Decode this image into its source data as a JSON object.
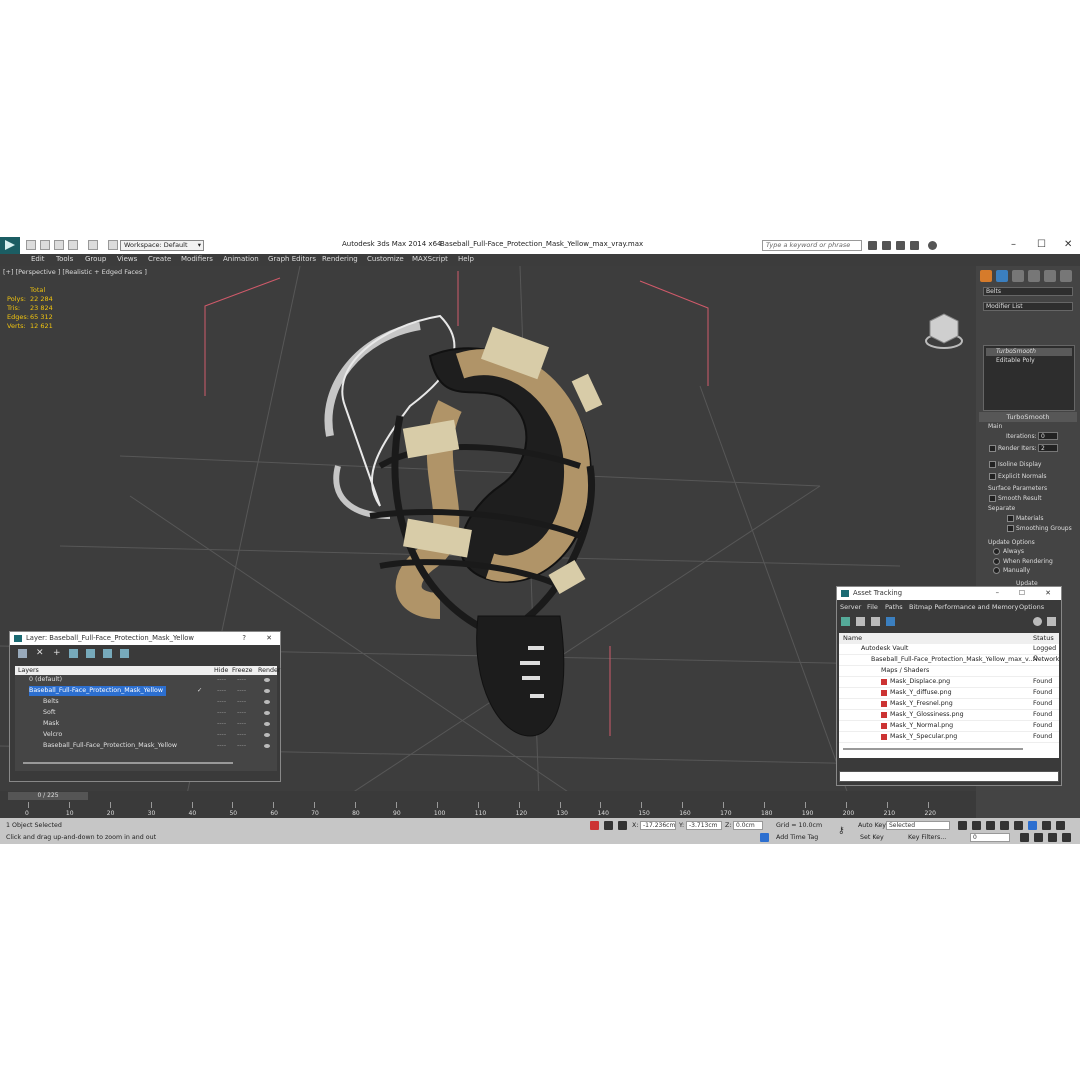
{
  "titlebar": {
    "workspace": "Workspace: Default",
    "app_title": "Autodesk 3ds Max  2014 x64",
    "file_name": "Baseball_Full-Face_Protection_Mask_Yellow_max_vray.max",
    "search_placeholder": "Type a keyword or phrase"
  },
  "menu": [
    "Edit",
    "Tools",
    "Group",
    "Views",
    "Create",
    "Modifiers",
    "Animation",
    "Graph Editors",
    "Rendering",
    "Customize",
    "MAXScript",
    "Help"
  ],
  "viewport": {
    "label": "[+] [Perspective ] [Realistic + Edged Faces ]",
    "stats": {
      "header": "Total",
      "rows": [
        {
          "k": "Polys:",
          "v": "22 284"
        },
        {
          "k": "Tris:",
          "v": "23 824"
        },
        {
          "k": "Edges:",
          "v": "65 312"
        },
        {
          "k": "Verts:",
          "v": "12 621"
        }
      ]
    }
  },
  "command_panel": {
    "object_name": "Belts",
    "modifier_list": "Modifier List",
    "stack": [
      "TurboSmooth",
      "Editable Poly"
    ],
    "rollout_title": "TurboSmooth",
    "main_label": "Main",
    "iterations_label": "Iterations:",
    "iterations_value": "0",
    "render_iters_label": "Render Iters:",
    "render_iters_value": "2",
    "isoline": "Isoline Display",
    "explicit": "Explicit Normals",
    "surface_params": "Surface Parameters",
    "smooth_result": "Smooth Result",
    "separate": "Separate",
    "materials": "Materials",
    "smoothing_groups": "Smoothing Groups",
    "update_options": "Update Options",
    "always": "Always",
    "when_rendering": "When Rendering",
    "manually": "Manually",
    "update_btn": "Update"
  },
  "layer_window": {
    "title": "Layer: Baseball_Full-Face_Protection_Mask_Yellow",
    "help": "?",
    "close": "✕",
    "columns": {
      "layers": "Layers",
      "hide": "Hide",
      "freeze": "Freeze",
      "render": "Render"
    },
    "rows": [
      {
        "name": "0 (default)"
      },
      {
        "name": "Baseball_Full-Face_Protection_Mask_Yellow"
      },
      {
        "name": "Belts"
      },
      {
        "name": "Soft"
      },
      {
        "name": "Mask"
      },
      {
        "name": "Velcro"
      },
      {
        "name": "Baseball_Full-Face_Protection_Mask_Yellow"
      }
    ],
    "dash": "----"
  },
  "asset_window": {
    "title": "Asset Tracking",
    "menu": [
      "Server",
      "File",
      "Paths",
      "Bitmap Performance and Memory",
      "Options"
    ],
    "columns": {
      "name": "Name",
      "status": "Status"
    },
    "rows": [
      {
        "name": "Autodesk Vault",
        "status": "Logged O"
      },
      {
        "name": "Baseball_Full-Face_Protection_Mask_Yellow_max_v...",
        "status": "Network"
      },
      {
        "name": "Maps / Shaders",
        "status": ""
      },
      {
        "name": "Mask_Displace.png",
        "status": "Found"
      },
      {
        "name": "Mask_Y_diffuse.png",
        "status": "Found"
      },
      {
        "name": "Mask_Y_Fresnel.png",
        "status": "Found"
      },
      {
        "name": "Mask_Y_Glossiness.png",
        "status": "Found"
      },
      {
        "name": "Mask_Y_Normal.png",
        "status": "Found"
      },
      {
        "name": "Mask_Y_Specular.png",
        "status": "Found"
      }
    ]
  },
  "timeline": {
    "frame": "0 / 225",
    "ticks": [
      "0",
      "10",
      "20",
      "30",
      "40",
      "50",
      "60",
      "70",
      "80",
      "90",
      "100",
      "110",
      "120",
      "130",
      "140",
      "150",
      "160",
      "170",
      "180",
      "190",
      "200",
      "210",
      "220"
    ]
  },
  "status": {
    "selected": "1 Object Selected",
    "hint": "Click and drag up-and-down to zoom in and out",
    "x_label": "X:",
    "x_value": "-17.236cm",
    "y_label": "Y:",
    "y_value": "-3.713cm",
    "z_label": "Z:",
    "z_value": "0.0cm",
    "grid": "Grid = 10.0cm",
    "add_time_tag": "Add Time Tag",
    "auto_key": "Auto Key",
    "auto_key_value": "Selected",
    "set_key": "Set Key",
    "key_filters": "Key Filters...",
    "frame_value": "0"
  },
  "colors": {
    "yellow_stats": "#f1c40f",
    "viewport_bg": "#3d3d3d",
    "selection": "#2c6fd0",
    "pad_tan": "#b09468"
  }
}
